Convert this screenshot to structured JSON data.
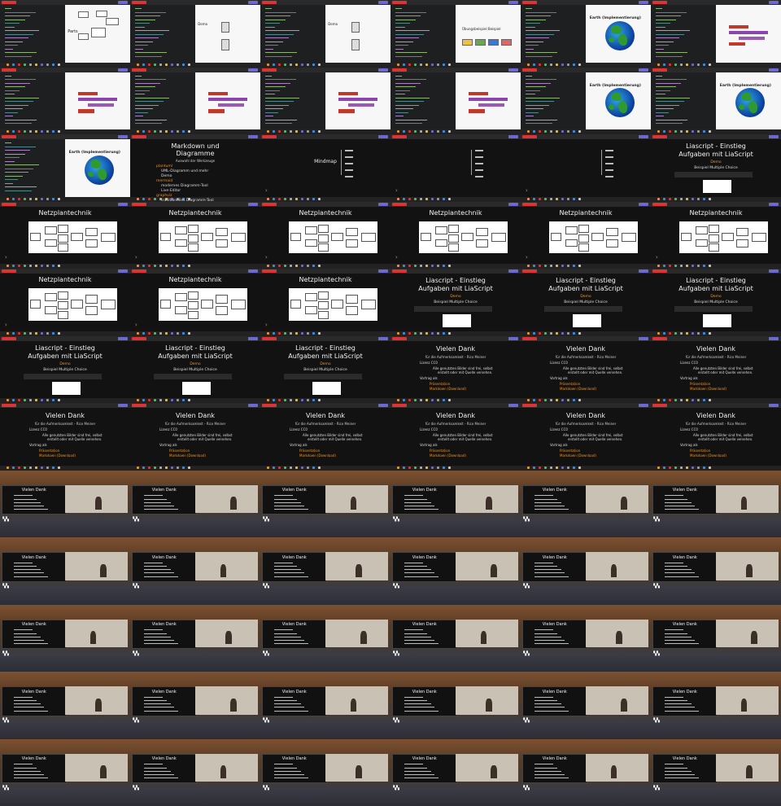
{
  "grid": {
    "columns": 6,
    "rows": 12
  },
  "texts": {
    "markdown_title": "Markdown und Diagramme",
    "markdown_subtitle": "Auswahl der Werkzeuge",
    "markdown_items": [
      "plantuml",
      "UML-Diagramm und mehr",
      "Demo",
      "mermaid",
      "modernes Diagramm-Tool",
      "Live-Editor",
      "graphviz",
      "traditionelles Diagramm-Tool"
    ],
    "mindmap": "Mindmap",
    "netzplan": "Netzplantechnik",
    "lia_title_1": "Liascript - Einstieg",
    "lia_title_2": "Aufgaben mit LiaScript",
    "lia_demo": "Demo",
    "lia_example": "Beispiel Multiple Choice",
    "dank_title": "Vielen Dank",
    "dank_sub": "für die Aufmerksamkeit - Rico Meiner",
    "dank_lizenz": "Lizenz CC0",
    "dank_bilder_1": "Alle genutzten Bilder sind frei, selbst",
    "dank_bilder_2": "erstellt oder mit Quelle versehen.",
    "dank_vortrag": "Vortrag als",
    "dank_praes": "Präsentation",
    "dank_markdown": "Markdown (Download)",
    "parts": "Parts",
    "demo": "Demo",
    "beispiel": "Übungsbeispiel Beispiel",
    "earth_label": "Earth (Implementierung)"
  },
  "colors": {
    "accent": "#e7942b",
    "slide_bg": "#121212",
    "editor_bg": "#1d1f21",
    "ocean": "#1565c0",
    "land": "#2f9a2f"
  }
}
